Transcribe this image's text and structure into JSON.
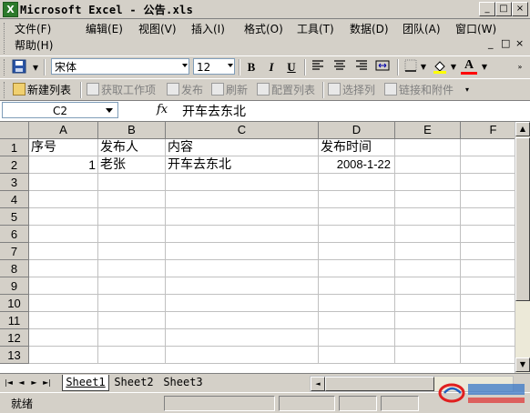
{
  "window": {
    "title": "Microsoft Excel - 公告.xls",
    "buttons": [
      "_",
      "□",
      "×"
    ]
  },
  "menu": {
    "items": [
      "文件(F)",
      "编辑(E)",
      "视图(V)",
      "插入(I)",
      "格式(O)",
      "工具(T)",
      "数据(D)",
      "团队(A)",
      "窗口(W)",
      "帮助(H)"
    ],
    "mdi_buttons": [
      "_",
      "□",
      "×"
    ]
  },
  "format_toolbar": {
    "font_name": "宋体",
    "font_size": "12",
    "bold": "B",
    "italic": "I",
    "underline": "U",
    "font_color_letter": "A",
    "colors": {
      "fill": "#ffff00",
      "font": "#ff0000"
    }
  },
  "team_toolbar": {
    "items": [
      "新建列表",
      "获取工作项",
      "发布",
      "刷新",
      "配置列表",
      "选择列",
      "链接和附件"
    ]
  },
  "formula_bar": {
    "cell_ref": "C2",
    "fx": "fx",
    "content": "开车去东北"
  },
  "grid": {
    "columns": [
      "A",
      "B",
      "C",
      "D",
      "E",
      "F"
    ],
    "rows": [
      "1",
      "2",
      "3",
      "4",
      "5",
      "6",
      "7",
      "8",
      "9",
      "10",
      "11",
      "12",
      "13"
    ],
    "cells": {
      "A1": "序号",
      "B1": "发布人",
      "C1": "内容",
      "D1": "发布时间",
      "A2": "1",
      "B2": "老张",
      "C2": "开车去东北",
      "D2": "2008-1-22"
    }
  },
  "sheets": [
    "Sheet1",
    "Sheet2",
    "Sheet3"
  ],
  "status": {
    "text": "就绪"
  }
}
